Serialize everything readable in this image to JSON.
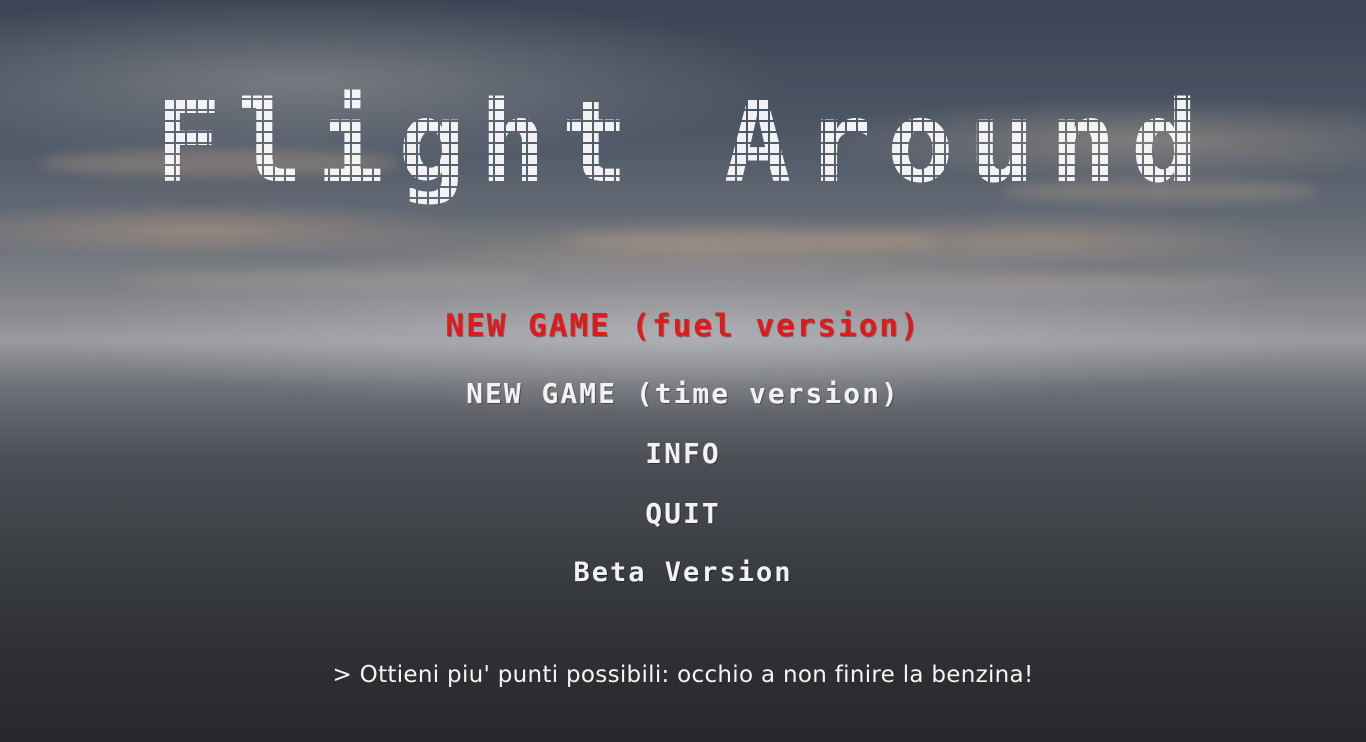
{
  "title": "Flight Around",
  "menu": {
    "items": [
      {
        "label": "NEW GAME (fuel version)",
        "selected": true
      },
      {
        "label": "NEW GAME (time version)",
        "selected": false
      },
      {
        "label": "INFO",
        "selected": false
      },
      {
        "label": "QUIT",
        "selected": false
      }
    ]
  },
  "version_label": "Beta Version",
  "hint": "> Ottieni piu' punti possibili: occhio a non finire la benzina!",
  "colors": {
    "selected_item": "#e01a1a",
    "menu_text": "#f2f2f2",
    "title": "#ffffff"
  }
}
